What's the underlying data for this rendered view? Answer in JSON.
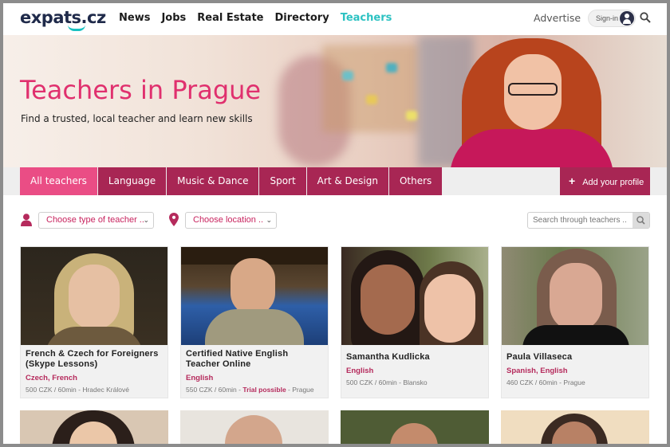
{
  "header": {
    "logo": "expats.cz",
    "nav": [
      "News",
      "Jobs",
      "Real Estate",
      "Directory",
      "Teachers"
    ],
    "advertise": "Advertise",
    "signin": "Sign-in"
  },
  "hero": {
    "title": "Teachers in Prague",
    "subtitle": "Find a trusted, local teacher and learn new skills"
  },
  "tabs": [
    "All teachers",
    "Language",
    "Music & Dance",
    "Sport",
    "Art & Design",
    "Others"
  ],
  "add_profile": "Add your profile",
  "filters": {
    "type_select": "Choose type of teacher ..",
    "location_select": "Choose location ..",
    "search_placeholder": "Search through teachers .."
  },
  "teachers": [
    {
      "title": "French & Czech for Foreigners (Skype Lessons)",
      "languages": "Czech, French",
      "meta": "500 CZK / 60min - Hradec Králové",
      "trial": ""
    },
    {
      "title": "Certified Native English Teacher Online",
      "languages": "English",
      "meta_pre": "550 CZK / 60min - ",
      "trial": "Trial possible",
      "meta_post": " - Prague"
    },
    {
      "title": "Samantha Kudlicka",
      "languages": "English",
      "meta": "500 CZK / 60min - Blansko",
      "trial": ""
    },
    {
      "title": "Paula Villaseca",
      "languages": "Spanish, English",
      "meta": "460 CZK / 60min - Prague",
      "trial": ""
    }
  ]
}
